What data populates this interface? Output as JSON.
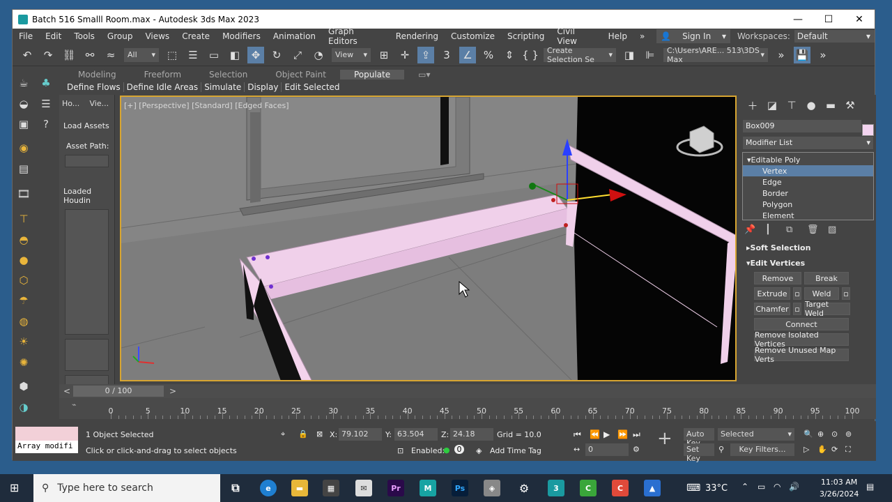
{
  "window": {
    "title": "Batch 516 Smalll Room.max - Autodesk 3ds Max 2023",
    "min": "—",
    "max": "☐",
    "close": "✕"
  },
  "menu": [
    "File",
    "Edit",
    "Tools",
    "Group",
    "Views",
    "Create",
    "Modifiers",
    "Animation",
    "Graph Editors",
    "Rendering",
    "Customize",
    "Scripting",
    "Civil View",
    "Help"
  ],
  "sign_in": "Sign In",
  "workspaces_label": "Workspaces:",
  "workspaces_value": "Default",
  "toolbar": {
    "filter": "All",
    "refcoord": "View",
    "selection_set": "Create Selection Se",
    "path": "C:\\Users\\ARE... 513\\3DS Max"
  },
  "ribbon_tabs": [
    "Modeling",
    "Freeform",
    "Selection",
    "Object Paint",
    "Populate"
  ],
  "ribbon_buttons": [
    "Define Flows",
    "Define Idle Areas",
    "Simulate",
    "Display",
    "Edit Selected"
  ],
  "left_panel": {
    "tab1": "Ho...",
    "tab2": "Vie...",
    "load_assets": "Load Assets",
    "asset_path": "Asset Path:",
    "loaded": "Loaded Houdin"
  },
  "viewport": {
    "label": "[+] [Perspective] [Standard] [Edged Faces]"
  },
  "command_panel": {
    "object_name": "Box009",
    "modifier_list": "Modifier List",
    "stack_top": "Editable Poly",
    "stack_items": [
      "Vertex",
      "Edge",
      "Border",
      "Polygon",
      "Element"
    ],
    "soft_selection": "Soft Selection",
    "edit_vertices": "Edit Vertices",
    "btn_remove": "Remove",
    "btn_break": "Break",
    "btn_extrude": "Extrude",
    "btn_weld": "Weld",
    "btn_chamfer": "Chamfer",
    "btn_target_weld": "Target Weld",
    "btn_connect": "Connect",
    "btn_remove_isolated": "Remove Isolated Vertices",
    "btn_remove_unused": "Remove Unused Map Verts"
  },
  "timeline": {
    "frame": "0 / 100",
    "ticks": [
      "0",
      "5",
      "10",
      "15",
      "20",
      "25",
      "30",
      "35",
      "40",
      "45",
      "50",
      "55",
      "60",
      "65",
      "70",
      "75",
      "80",
      "85",
      "90",
      "95",
      "100"
    ]
  },
  "status": {
    "modifier_field": "Array modifi",
    "selected": "1 Object Selected",
    "prompt": "Click or click-and-drag to select objects",
    "x_label": "X:",
    "x": "79.102",
    "y_label": "Y:",
    "y": "63.504",
    "z_label": "Z:",
    "z": "24.18",
    "grid": "Grid = 10.0",
    "enabled": "Enabled:",
    "add_time_tag": "Add Time Tag",
    "auto_key": "Auto Key",
    "selected_dd": "Selected",
    "set_key": "Set Key",
    "key_filters": "Key Filters...",
    "frame_field": "0"
  },
  "taskbar": {
    "search": "Type here to search",
    "temp": "33°C",
    "time": "11:03 AM",
    "date": "3/26/2024"
  }
}
